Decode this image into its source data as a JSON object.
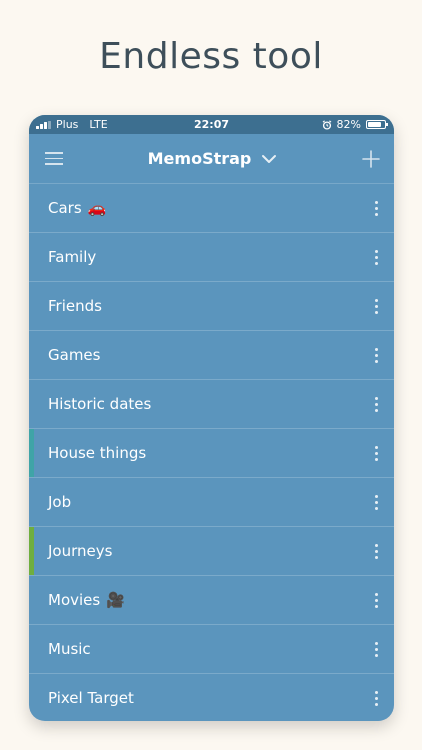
{
  "headline": "Endless tool",
  "status": {
    "carrier": "Plus",
    "network": "LTE",
    "time": "22:07",
    "battery": "82%",
    "battery_level": 0.82
  },
  "nav": {
    "title": "MemoStrap"
  },
  "items": [
    {
      "label": "Cars",
      "emoji": "🚗",
      "accent": ""
    },
    {
      "label": "Family",
      "emoji": "",
      "accent": ""
    },
    {
      "label": "Friends",
      "emoji": "",
      "accent": ""
    },
    {
      "label": "Games",
      "emoji": "",
      "accent": ""
    },
    {
      "label": "Historic dates",
      "emoji": "",
      "accent": ""
    },
    {
      "label": "House things",
      "emoji": "",
      "accent": "#3fa4a7"
    },
    {
      "label": "Job",
      "emoji": "",
      "accent": ""
    },
    {
      "label": "Journeys",
      "emoji": "",
      "accent": "#6fae3e"
    },
    {
      "label": "Movies",
      "emoji": "🎥",
      "accent": ""
    },
    {
      "label": "Music",
      "emoji": "",
      "accent": ""
    },
    {
      "label": "Pixel Target",
      "emoji": "",
      "accent": ""
    }
  ],
  "colors": {
    "background": "#fcf8f1",
    "headline": "#3e4f5a",
    "app": "#5b95bd",
    "statusbar": "#3d6f90"
  },
  "icons": {
    "menu": "hamburger-icon",
    "dropdown": "chevron-down-icon",
    "add": "plus-icon",
    "row_menu": "more-vertical-icon",
    "alarm": "alarm-icon",
    "battery": "battery-icon",
    "signal": "signal-icon"
  }
}
